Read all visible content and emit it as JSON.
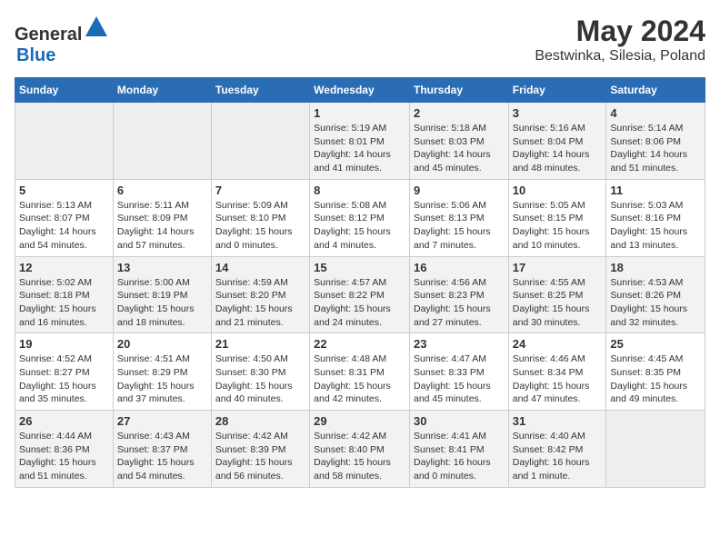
{
  "header": {
    "logo": {
      "general": "General",
      "blue": "Blue"
    },
    "title": "May 2024",
    "subtitle": "Bestwinka, Silesia, Poland"
  },
  "calendar": {
    "headers": [
      "Sunday",
      "Monday",
      "Tuesday",
      "Wednesday",
      "Thursday",
      "Friday",
      "Saturday"
    ],
    "rows": [
      [
        {
          "day": "",
          "info": ""
        },
        {
          "day": "",
          "info": ""
        },
        {
          "day": "",
          "info": ""
        },
        {
          "day": "1",
          "info": "Sunrise: 5:19 AM\nSunset: 8:01 PM\nDaylight: 14 hours\nand 41 minutes."
        },
        {
          "day": "2",
          "info": "Sunrise: 5:18 AM\nSunset: 8:03 PM\nDaylight: 14 hours\nand 45 minutes."
        },
        {
          "day": "3",
          "info": "Sunrise: 5:16 AM\nSunset: 8:04 PM\nDaylight: 14 hours\nand 48 minutes."
        },
        {
          "day": "4",
          "info": "Sunrise: 5:14 AM\nSunset: 8:06 PM\nDaylight: 14 hours\nand 51 minutes."
        }
      ],
      [
        {
          "day": "5",
          "info": "Sunrise: 5:13 AM\nSunset: 8:07 PM\nDaylight: 14 hours\nand 54 minutes."
        },
        {
          "day": "6",
          "info": "Sunrise: 5:11 AM\nSunset: 8:09 PM\nDaylight: 14 hours\nand 57 minutes."
        },
        {
          "day": "7",
          "info": "Sunrise: 5:09 AM\nSunset: 8:10 PM\nDaylight: 15 hours\nand 0 minutes."
        },
        {
          "day": "8",
          "info": "Sunrise: 5:08 AM\nSunset: 8:12 PM\nDaylight: 15 hours\nand 4 minutes."
        },
        {
          "day": "9",
          "info": "Sunrise: 5:06 AM\nSunset: 8:13 PM\nDaylight: 15 hours\nand 7 minutes."
        },
        {
          "day": "10",
          "info": "Sunrise: 5:05 AM\nSunset: 8:15 PM\nDaylight: 15 hours\nand 10 minutes."
        },
        {
          "day": "11",
          "info": "Sunrise: 5:03 AM\nSunset: 8:16 PM\nDaylight: 15 hours\nand 13 minutes."
        }
      ],
      [
        {
          "day": "12",
          "info": "Sunrise: 5:02 AM\nSunset: 8:18 PM\nDaylight: 15 hours\nand 16 minutes."
        },
        {
          "day": "13",
          "info": "Sunrise: 5:00 AM\nSunset: 8:19 PM\nDaylight: 15 hours\nand 18 minutes."
        },
        {
          "day": "14",
          "info": "Sunrise: 4:59 AM\nSunset: 8:20 PM\nDaylight: 15 hours\nand 21 minutes."
        },
        {
          "day": "15",
          "info": "Sunrise: 4:57 AM\nSunset: 8:22 PM\nDaylight: 15 hours\nand 24 minutes."
        },
        {
          "day": "16",
          "info": "Sunrise: 4:56 AM\nSunset: 8:23 PM\nDaylight: 15 hours\nand 27 minutes."
        },
        {
          "day": "17",
          "info": "Sunrise: 4:55 AM\nSunset: 8:25 PM\nDaylight: 15 hours\nand 30 minutes."
        },
        {
          "day": "18",
          "info": "Sunrise: 4:53 AM\nSunset: 8:26 PM\nDaylight: 15 hours\nand 32 minutes."
        }
      ],
      [
        {
          "day": "19",
          "info": "Sunrise: 4:52 AM\nSunset: 8:27 PM\nDaylight: 15 hours\nand 35 minutes."
        },
        {
          "day": "20",
          "info": "Sunrise: 4:51 AM\nSunset: 8:29 PM\nDaylight: 15 hours\nand 37 minutes."
        },
        {
          "day": "21",
          "info": "Sunrise: 4:50 AM\nSunset: 8:30 PM\nDaylight: 15 hours\nand 40 minutes."
        },
        {
          "day": "22",
          "info": "Sunrise: 4:48 AM\nSunset: 8:31 PM\nDaylight: 15 hours\nand 42 minutes."
        },
        {
          "day": "23",
          "info": "Sunrise: 4:47 AM\nSunset: 8:33 PM\nDaylight: 15 hours\nand 45 minutes."
        },
        {
          "day": "24",
          "info": "Sunrise: 4:46 AM\nSunset: 8:34 PM\nDaylight: 15 hours\nand 47 minutes."
        },
        {
          "day": "25",
          "info": "Sunrise: 4:45 AM\nSunset: 8:35 PM\nDaylight: 15 hours\nand 49 minutes."
        }
      ],
      [
        {
          "day": "26",
          "info": "Sunrise: 4:44 AM\nSunset: 8:36 PM\nDaylight: 15 hours\nand 51 minutes."
        },
        {
          "day": "27",
          "info": "Sunrise: 4:43 AM\nSunset: 8:37 PM\nDaylight: 15 hours\nand 54 minutes."
        },
        {
          "day": "28",
          "info": "Sunrise: 4:42 AM\nSunset: 8:39 PM\nDaylight: 15 hours\nand 56 minutes."
        },
        {
          "day": "29",
          "info": "Sunrise: 4:42 AM\nSunset: 8:40 PM\nDaylight: 15 hours\nand 58 minutes."
        },
        {
          "day": "30",
          "info": "Sunrise: 4:41 AM\nSunset: 8:41 PM\nDaylight: 16 hours\nand 0 minutes."
        },
        {
          "day": "31",
          "info": "Sunrise: 4:40 AM\nSunset: 8:42 PM\nDaylight: 16 hours\nand 1 minute."
        },
        {
          "day": "",
          "info": ""
        }
      ]
    ]
  }
}
